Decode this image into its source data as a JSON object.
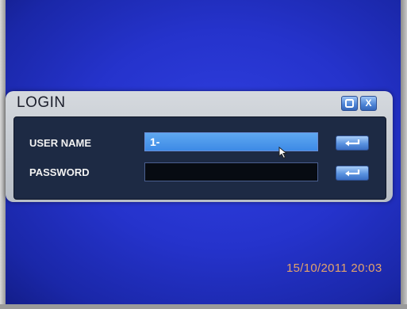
{
  "dialog": {
    "title": "LOGIN",
    "settings_icon": "gear-icon",
    "close_icon": "close-icon",
    "close_label": "X"
  },
  "form": {
    "user_label": "USER NAME",
    "user_value": "1-",
    "password_label": "PASSWORD",
    "password_value": "",
    "enter_icon": "enter-arrow-icon"
  },
  "status": {
    "timestamp": "15/10/2011 20:03"
  },
  "colors": {
    "background": "#2533cc",
    "field_active": "#3d8ae6",
    "field_inactive": "#070b12",
    "timestamp": "#e3a26a"
  }
}
